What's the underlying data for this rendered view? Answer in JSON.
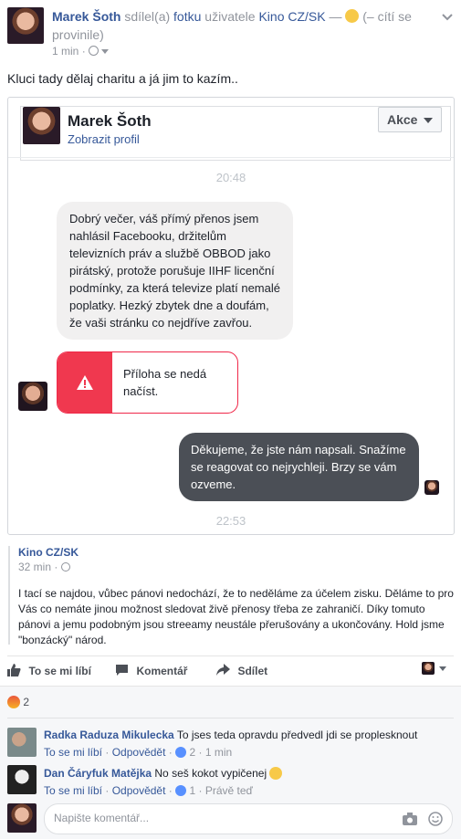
{
  "post": {
    "author": "Marek Šoth",
    "shared_text": "sdílel(a)",
    "shared_object": "fotku",
    "shared_user_prefix": "uživatele",
    "shared_page": "Kino CZ/SK",
    "feeling_dash": "—",
    "feeling_text": "(– cítí se provinile)",
    "time": "1 min",
    "dot": "·",
    "text": "Kluci tady dělaj charitu a já jim to kazím.."
  },
  "messenger": {
    "name": "Marek Šoth",
    "profile_link": "Zobrazit profil",
    "akce_label": "Akce",
    "time1": "20:48",
    "incoming_message": "Dobrý večer, váš přímý přenos jsem nahlásil Facebooku, držitelům televizních práv a službě OBBOD jako pirátský, protože porušuje IIHF licenční podmínky, za která televize platí nemalé poplatky. Hezký zbytek dne a doufám, že vaši stránku co nejdříve zavřou.",
    "attachment_error": "Příloha se nedá načíst.",
    "outgoing_message": "Děkujeme, že jste nám napsali. Snažíme se reagovat co nejrychleji. Brzy se vám ozveme.",
    "time2": "22:53"
  },
  "page_post": {
    "page_name": "Kino CZ/SK",
    "time": "32 min",
    "text": "I tací se najdou, vůbec pánovi nedochází, že to neděláme za účelem zisku. Děláme to pro Vás co nemáte jinou možnost sledovat živě přenosy třeba ze zahraničí. Díky tomuto pánovi a jemu podobným jsou streeamy neustále přerušovány a ukončovány. Hold jsme \"bonzácký\" národ."
  },
  "actions": {
    "like": "To se mi líbí",
    "comment": "Komentář",
    "share": "Sdílet"
  },
  "reactions": {
    "count": "2"
  },
  "comments": [
    {
      "author": "Radka Raduza Mikulecka",
      "text": "To jses teda opravdu předvedl jdi se proplesknout",
      "like": "To se mi líbí",
      "reply": "Odpovědět",
      "likes": "2",
      "time": "1 min"
    },
    {
      "author": "Dan Čáryfuk Matějka",
      "text": "No seš kokot vypičenej",
      "like": "To se mi líbí",
      "reply": "Odpovědět",
      "likes": "1",
      "time": "Právě teď"
    }
  ],
  "composer": {
    "placeholder": "Napište komentář..."
  },
  "colors": {
    "link": "#365899",
    "error_red": "#f02849",
    "bubble_dark": "#4b4f56"
  },
  "icons": [
    "globe-icon",
    "chevron-down-icon",
    "warning-icon",
    "like-icon",
    "comment-icon",
    "share-icon",
    "angry-reaction-icon",
    "camera-icon",
    "emoji-icon"
  ]
}
